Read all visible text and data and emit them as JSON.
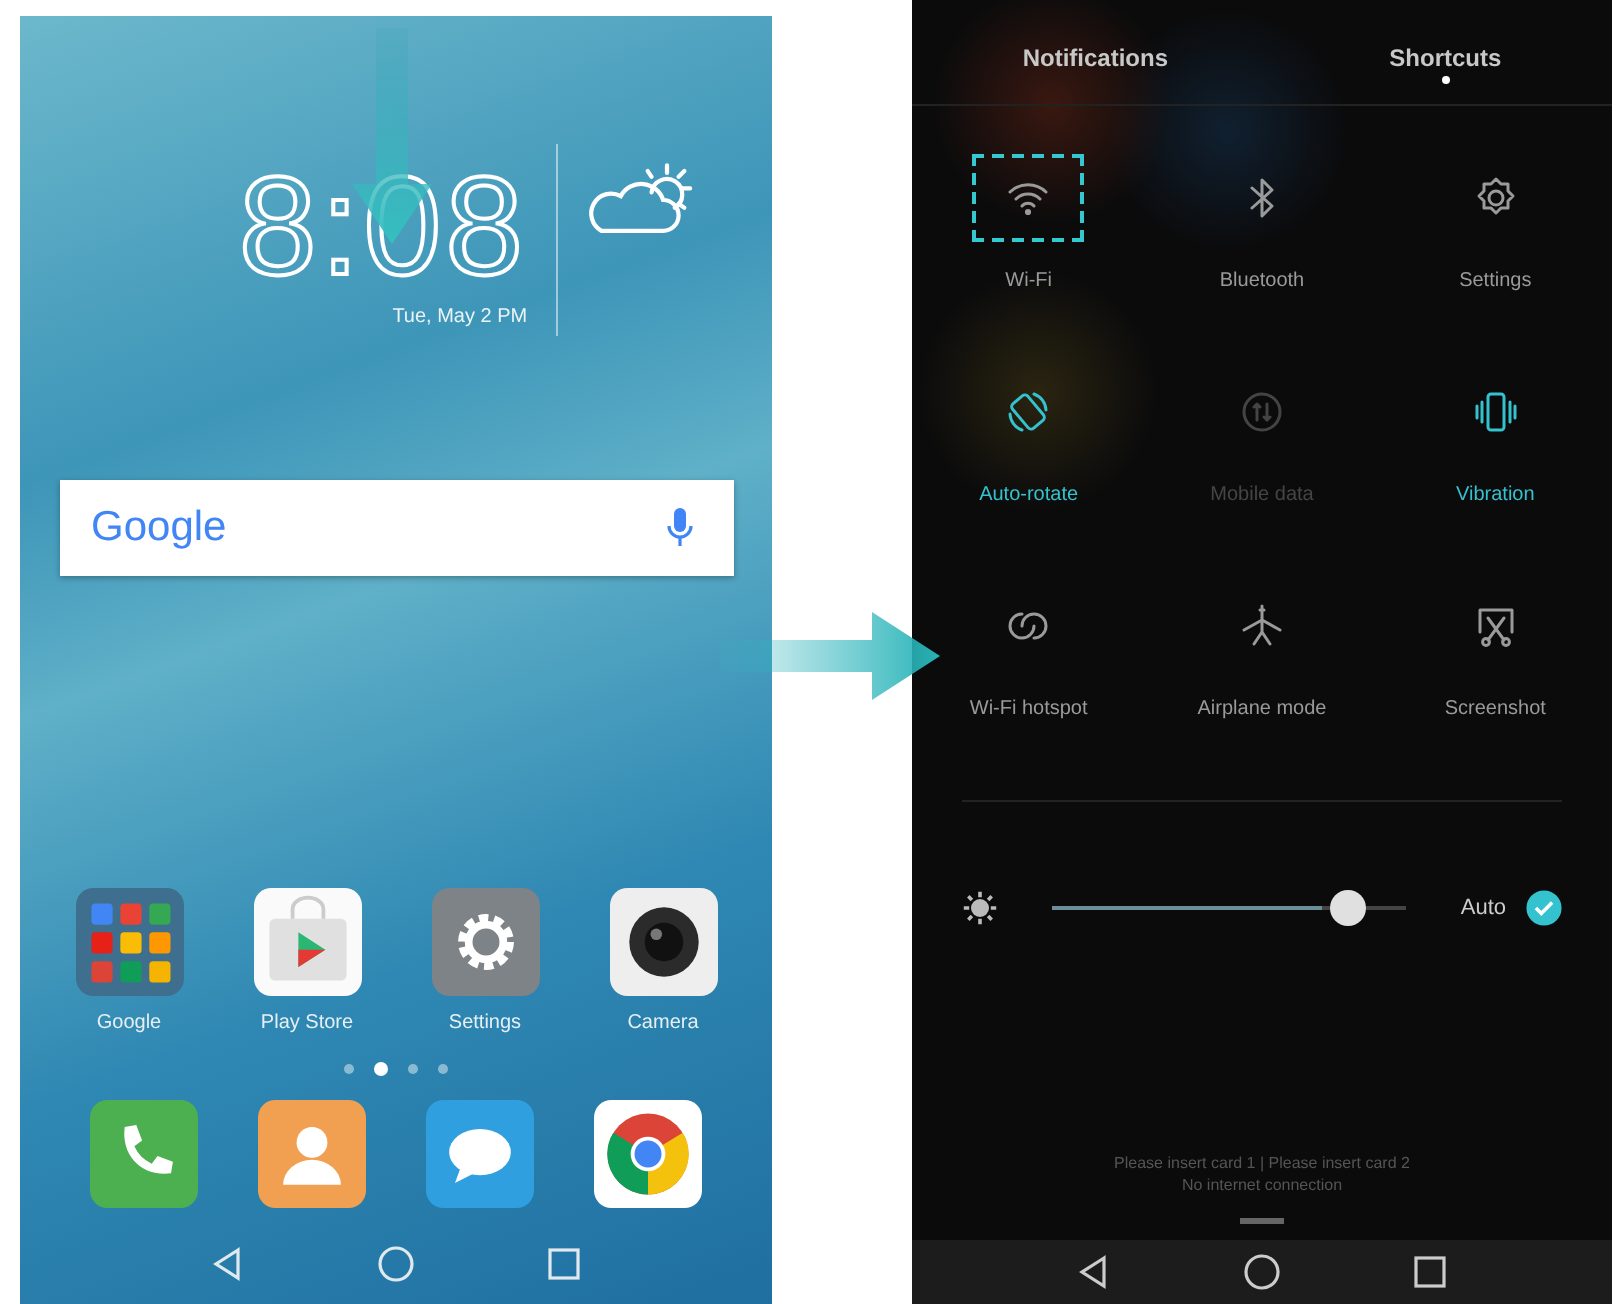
{
  "home_screen": {
    "clock": {
      "time": "8:08",
      "date": "Tue, May 2 PM"
    },
    "search": {
      "logo": "Google"
    },
    "apps": [
      {
        "kind": "folder",
        "label": "Google"
      },
      {
        "kind": "store",
        "label": "Play Store"
      },
      {
        "kind": "settings",
        "label": "Settings"
      },
      {
        "kind": "camera",
        "label": "Camera"
      }
    ],
    "page_dots": [
      {
        "selected": false
      },
      {
        "selected": true
      },
      {
        "selected": false
      },
      {
        "selected": false
      }
    ],
    "dock": [
      {
        "kind": "phone"
      },
      {
        "kind": "contacts"
      },
      {
        "kind": "messages"
      },
      {
        "kind": "browser"
      }
    ]
  },
  "shortcuts_panel": {
    "tabs": [
      {
        "label": "Notifications",
        "selected": false
      },
      {
        "label": "Shortcuts",
        "selected": true
      }
    ],
    "tiles": [
      {
        "kind": "wifi",
        "label": "Wi-Fi",
        "on": false,
        "disabled": false,
        "highlighted": true
      },
      {
        "kind": "bluetooth",
        "label": "Bluetooth",
        "on": false,
        "disabled": false,
        "highlighted": false
      },
      {
        "kind": "settings",
        "label": "Settings",
        "on": false,
        "disabled": false,
        "highlighted": false
      },
      {
        "kind": "rotate",
        "label": "Auto-rotate",
        "on": true,
        "disabled": false,
        "highlighted": false
      },
      {
        "kind": "data",
        "label": "Mobile data",
        "on": false,
        "disabled": true,
        "highlighted": false
      },
      {
        "kind": "vibration",
        "label": "Vibration",
        "on": true,
        "disabled": false,
        "highlighted": false
      },
      {
        "kind": "hotspot",
        "label": "Wi-Fi hotspot",
        "on": false,
        "disabled": false,
        "highlighted": false
      },
      {
        "kind": "airplane",
        "label": "Airplane mode",
        "on": false,
        "disabled": false,
        "highlighted": false
      },
      {
        "kind": "screenshot",
        "label": "Screenshot",
        "on": false,
        "disabled": false,
        "highlighted": false
      }
    ],
    "brightness": {
      "level": 0.76,
      "auto_label": "Auto",
      "auto_checked": true
    },
    "sim_status": [
      "Please insert card 1 | Please insert card 2",
      "No internet connection"
    ]
  }
}
